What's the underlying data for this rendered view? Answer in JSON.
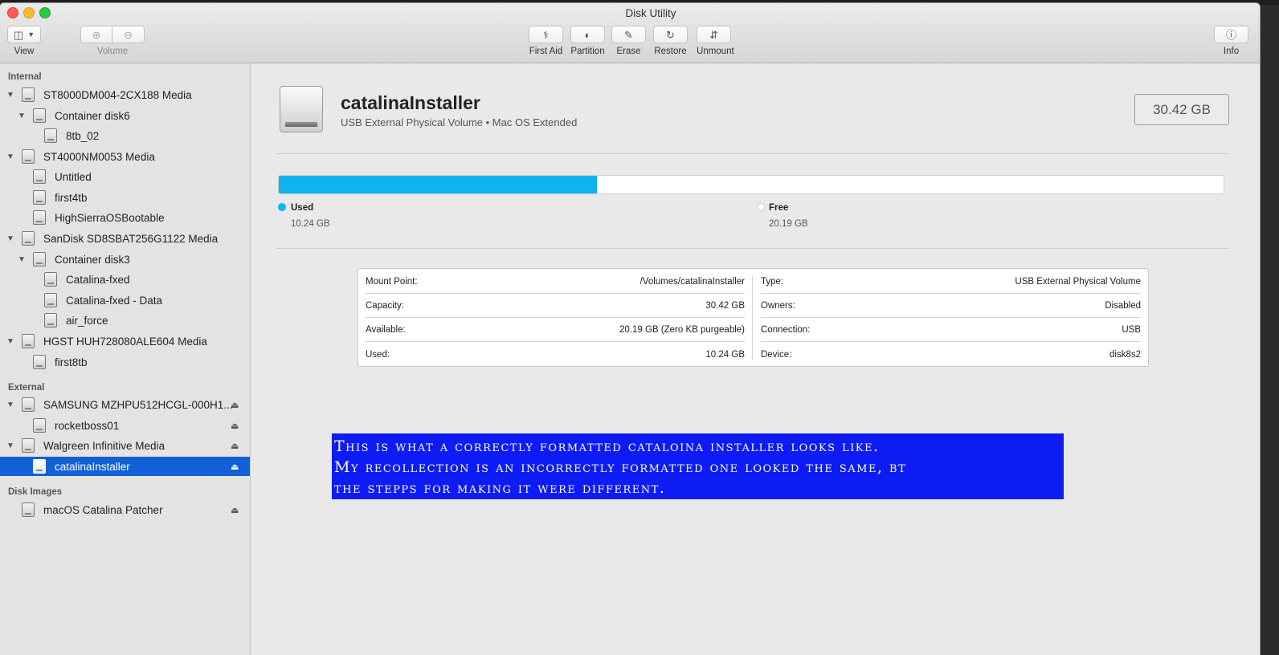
{
  "window": {
    "title": "Disk Utility"
  },
  "toolbar": {
    "view_label": "View",
    "volume_label": "Volume",
    "first_aid_label": "First Aid",
    "partition_label": "Partition",
    "erase_label": "Erase",
    "restore_label": "Restore",
    "unmount_label": "Unmount",
    "info_label": "Info"
  },
  "sidebar": {
    "internal_label": "Internal",
    "external_label": "External",
    "images_label": "Disk Images",
    "items": [
      {
        "label": "ST8000DM004-2CX188 Media"
      },
      {
        "label": "Container disk6"
      },
      {
        "label": "8tb_02"
      },
      {
        "label": "ST4000NM0053 Media"
      },
      {
        "label": "Untitled"
      },
      {
        "label": "first4tb"
      },
      {
        "label": "HighSierraOSBootable"
      },
      {
        "label": "SanDisk SD8SBAT256G1122 Media"
      },
      {
        "label": "Container disk3"
      },
      {
        "label": "Catalina-fxed"
      },
      {
        "label": "Catalina-fxed - Data"
      },
      {
        "label": "air_force"
      },
      {
        "label": "HGST HUH728080ALE604 Media"
      },
      {
        "label": "first8tb"
      },
      {
        "label": "SAMSUNG MZHPU512HCGL-000H1..."
      },
      {
        "label": "rocketboss01"
      },
      {
        "label": "Walgreen Infinitive Media"
      },
      {
        "label": "catalinaInstaller"
      },
      {
        "label": "macOS Catalina Patcher"
      }
    ]
  },
  "volume": {
    "name": "catalinaInstaller",
    "subtitle": "USB External Physical Volume • Mac OS Extended",
    "size": "30.42 GB"
  },
  "usage": {
    "used_fraction": 0.3366,
    "used_title": "Used",
    "used_value": "10.24 GB",
    "free_title": "Free",
    "free_value": "20.19 GB",
    "used_color": "#10b2f0"
  },
  "info": {
    "left": [
      {
        "key": "Mount Point:",
        "value": "/Volumes/catalinaInstaller"
      },
      {
        "key": "Capacity:",
        "value": "30.42 GB"
      },
      {
        "key": "Available:",
        "value": "20.19 GB (Zero KB purgeable)"
      },
      {
        "key": "Used:",
        "value": "10.24 GB"
      }
    ],
    "right": [
      {
        "key": "Type:",
        "value": "USB External Physical Volume"
      },
      {
        "key": "Owners:",
        "value": "Disabled"
      },
      {
        "key": "Connection:",
        "value": "USB"
      },
      {
        "key": "Device:",
        "value": "disk8s2"
      }
    ]
  },
  "annotation": {
    "line1": "This is what a correctly formatted cataloina installer looks like.",
    "line2": "My recollection is an incorrectly formatted one looked the same, bt",
    "line3": "the stepps for making it were different."
  }
}
